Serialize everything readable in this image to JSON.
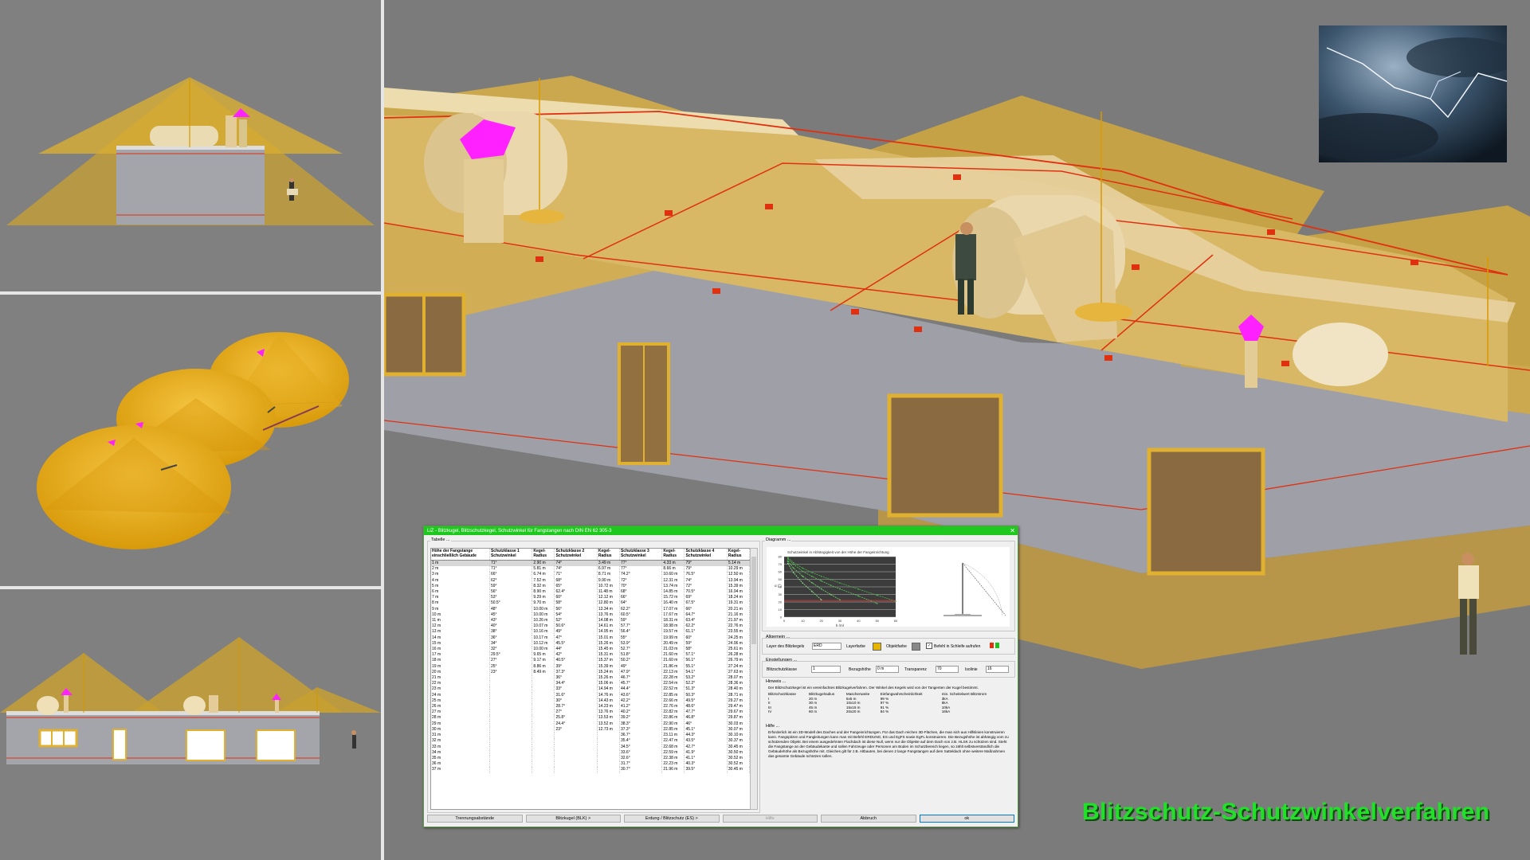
{
  "caption": "Blitzschutz-Schutzwinkelverfahren",
  "colors": {
    "cone": "#e3b31d",
    "building": "#d9b564",
    "wall_gray": "#9d9da6",
    "conductor": "#e03010",
    "roof_fixture": "#ff21ff",
    "caption_green": "#22e02a"
  },
  "icons": {
    "close": "close-icon",
    "color_swatch": "color-swatch-icon",
    "checkbox": "checkbox-icon"
  },
  "dialog": {
    "title": "LiZ - Blitzkugel, Blitzschutzkegel, Schutzwinkel für Fangstangen nach DIN EN 62 305-3",
    "close_glyph": "✕",
    "table_group": "Tabelle ...",
    "diagram_group": "Diagramm ...",
    "diagram_title": "Schutzwinkel in Abhängigkeit von der Höhe der Fangeinrichtung",
    "headers": [
      "Höhe der Fangstange einschließlich Gebäude",
      "Schutzklasse 1 Schutzwinkel",
      "Kegel-Radius",
      "Schutzklasse 2 Schutzwinkel",
      "Kegel-Radius",
      "Schutzklasse 3 Schutzwinkel",
      "Kegel-Radius",
      "Schutzklasse 4 Schutzwinkel",
      "Kegel-Radius"
    ],
    "rows": [
      [
        "1 m",
        "71°",
        "2.90 m",
        "74°",
        "3.49 m",
        "77°",
        "4.33 m",
        "79°",
        "5.14 m"
      ],
      [
        "2 m",
        "71°",
        "5.81 m",
        "74°",
        "6.97 m",
        "77°",
        "8.66 m",
        "79°",
        "10.29 m"
      ],
      [
        "3 m",
        "66°",
        "6.74 m",
        "71°",
        "8.71 m",
        "74.2°",
        "10.60 m",
        "76.5°",
        "12.50 m"
      ],
      [
        "4 m",
        "62°",
        "7.52 m",
        "68°",
        "9.90 m",
        "72°",
        "12.31 m",
        "74°",
        "13.94 m"
      ],
      [
        "5 m",
        "59°",
        "8.32 m",
        "65°",
        "10.72 m",
        "70°",
        "13.74 m",
        "72°",
        "15.39 m"
      ],
      [
        "6 m",
        "56°",
        "8.90 m",
        "62.4°",
        "11.48 m",
        "68°",
        "14.85 m",
        "70.5°",
        "16.94 m"
      ],
      [
        "7 m",
        "53°",
        "9.29 m",
        "60°",
        "12.12 m",
        "66°",
        "15.72 m",
        "69°",
        "18.24 m"
      ],
      [
        "8 m",
        "50.5°",
        "9.70 m",
        "58°",
        "12.80 m",
        "64°",
        "16.40 m",
        "67.5°",
        "19.31 m"
      ],
      [
        "9 m",
        "48°",
        "10.00 m",
        "56°",
        "13.34 m",
        "62.2°",
        "17.07 m",
        "66°",
        "20.21 m"
      ],
      [
        "10 m",
        "45°",
        "10.00 m",
        "54°",
        "13.76 m",
        "60.5°",
        "17.67 m",
        "64.7°",
        "21.16 m"
      ],
      [
        "11 m",
        "43°",
        "10.26 m",
        "52°",
        "14.08 m",
        "59°",
        "18.31 m",
        "63.4°",
        "21.97 m"
      ],
      [
        "12 m",
        "40°",
        "10.07 m",
        "50.6°",
        "14.61 m",
        "57.7°",
        "18.98 m",
        "62.2°",
        "22.76 m"
      ],
      [
        "13 m",
        "38°",
        "10.16 m",
        "49°",
        "14.95 m",
        "56.4°",
        "19.57 m",
        "61.1°",
        "23.55 m"
      ],
      [
        "14 m",
        "36°",
        "10.17 m",
        "47°",
        "15.01 m",
        "55°",
        "19.99 m",
        "60°",
        "24.25 m"
      ],
      [
        "15 m",
        "34°",
        "10.12 m",
        "45.5°",
        "15.26 m",
        "53.9°",
        "20.49 m",
        "59°",
        "24.96 m"
      ],
      [
        "16 m",
        "32°",
        "10.00 m",
        "44°",
        "15.45 m",
        "52.7°",
        "21.03 m",
        "58°",
        "25.61 m"
      ],
      [
        "17 m",
        "29.5°",
        "9.65 m",
        "42°",
        "15.31 m",
        "51.8°",
        "21.60 m",
        "57.1°",
        "26.28 m"
      ],
      [
        "18 m",
        "27°",
        "9.17 m",
        "40.5°",
        "15.37 m",
        "50.2°",
        "21.60 m",
        "56.1°",
        "26.79 m"
      ],
      [
        "19 m",
        "25°",
        "8.86 m",
        "39°",
        "15.39 m",
        "49°",
        "21.86 m",
        "55.1°",
        "27.24 m"
      ],
      [
        "20 m",
        "23°",
        "8.49 m",
        "37.3°",
        "15.24 m",
        "47.9°",
        "22.13 m",
        "54.1°",
        "27.63 m"
      ],
      [
        "21 m",
        "",
        "",
        "36°",
        "15.26 m",
        "46.7°",
        "22.28 m",
        "53.2°",
        "28.07 m"
      ],
      [
        "22 m",
        "",
        "",
        "34.4°",
        "15.06 m",
        "45.7°",
        "22.54 m",
        "52.2°",
        "28.36 m"
      ],
      [
        "23 m",
        "",
        "",
        "33°",
        "14.94 m",
        "44.4°",
        "22.52 m",
        "51.3°",
        "28.40 m"
      ],
      [
        "24 m",
        "",
        "",
        "31.6°",
        "14.76 m",
        "43.6°",
        "22.85 m",
        "50.3°",
        "28.71 m"
      ],
      [
        "25 m",
        "",
        "",
        "30°",
        "14.43 m",
        "42.2°",
        "22.66 m",
        "49.5°",
        "29.27 m"
      ],
      [
        "26 m",
        "",
        "",
        "28.7°",
        "14.23 m",
        "41.2°",
        "22.76 m",
        "48.6°",
        "29.47 m"
      ],
      [
        "27 m",
        "",
        "",
        "27°",
        "13.76 m",
        "40.2°",
        "22.82 m",
        "47.7°",
        "29.67 m"
      ],
      [
        "28 m",
        "",
        "",
        "25.8°",
        "13.53 m",
        "39.2°",
        "22.86 m",
        "46.8°",
        "29.87 m"
      ],
      [
        "29 m",
        "",
        "",
        "24.4°",
        "13.52 m",
        "38.3°",
        "22.90 m",
        "46°",
        "30.03 m"
      ],
      [
        "30 m",
        "",
        "",
        "23°",
        "12.73 m",
        "37.3°",
        "22.85 m",
        "45.1°",
        "30.07 m"
      ],
      [
        "31 m",
        "",
        "",
        "",
        "",
        "36.7°",
        "23.11 m",
        "44.3°",
        "30.10 m"
      ],
      [
        "32 m",
        "",
        "",
        "",
        "",
        "35.4°",
        "22.47 m",
        "43.5°",
        "30.37 m"
      ],
      [
        "33 m",
        "",
        "",
        "",
        "",
        "34.5°",
        "22.68 m",
        "42.7°",
        "30.45 m"
      ],
      [
        "34 m",
        "",
        "",
        "",
        "",
        "33.6°",
        "22.59 m",
        "41.9°",
        "30.50 m"
      ],
      [
        "35 m",
        "",
        "",
        "",
        "",
        "32.6°",
        "22.38 m",
        "41.1°",
        "30.52 m"
      ],
      [
        "36 m",
        "",
        "",
        "",
        "",
        "31.7°",
        "22.23 m",
        "40.3°",
        "30.52 m"
      ],
      [
        "37 m",
        "",
        "",
        "",
        "",
        "30.7°",
        "21.96 m",
        "39.5°",
        "30.45 m"
      ]
    ],
    "general_group": "Allgemein ...",
    "layer_label": "Layer des Blitzkegels",
    "layer_value": "ERD",
    "layer_color_label": "Layerfarbe",
    "object_color_label": "Objektfarbe",
    "loop_label": "Befehl in Schleife aufrufen",
    "settings_group": "Einstellungen ...",
    "class_label": "Blitzschutzklasse",
    "class_value": "1",
    "refheight_label": "Bezugshöhe",
    "refheight_value": "0 m",
    "transparency_label": "Transparenz",
    "transparency_value": "70",
    "isolines_label": "Isolinie",
    "isolines_value": "16",
    "notes_group": "Hinweis ...",
    "notes_intro": "Der Blitzschutzkegel ist ein vereinfachtes Blitzkugelverfahren. Der Winkel des Kegels wird von der Tangenten der Kugel bestimmt.",
    "info_headers": [
      "Blitzschutzklasse",
      "Blitzkugelradius",
      "Maschenweite",
      "Einfangwahrscheinlichkeit",
      "min. Scheitelwert Blitzstrom"
    ],
    "info_rows": [
      [
        "I",
        "20 m",
        "5x5 m",
        "99 %",
        "3kA"
      ],
      [
        "II",
        "30 m",
        "10x10 m",
        "97 %",
        "5kA"
      ],
      [
        "III",
        "45 m",
        "15x15 m",
        "91 %",
        "10kA"
      ],
      [
        "IV",
        "60 m",
        "20x20 m",
        "84 %",
        "16kA"
      ]
    ],
    "help_title": "Hilfe ...",
    "help_text": "Erforderlich ist ein 3D-Modell des Daches und der Fangeinrichtungen. Für das Dach reichen 3D-Flächen, die man sich aus Hilfslinien konstruieren kann. Fangspitzen und Fangleitungen kann man mit Befehl ERDUNG, ES und EgFS sowie EgFL konstruieren. Die Bezugshöhe ist abhängig vom zu schützenden Objekt. Bei einem ausgedehnten Flachdach ist diese Null, wenn nur die Objekte auf dem Dach von z.B. HLSK zu schützen sind. Steht die Fangstange an der Gebäudekante und sollen Fahrzeuge oder Personen am Boden im Schutzbereich liegen, so zählt selbstverständlich die Gebäudehöhe als Bezugshöhe mit. Gleiches gilt für z.B. Altbauten, bei denen 2 lange Fangstangen auf dem Satteldach ohne weitere Maßnahmen das gesamte Gebäude schützen sollen.",
    "buttons": [
      "Trennungsabstände",
      "Blitzkugel (BLK) >",
      "Erdung / Blitzschutz (ES) >",
      "Hilfe",
      "Abbruch",
      "ok"
    ],
    "chart_data": {
      "type": "line",
      "title": "Schutzwinkel in Abhängigkeit von der Höhe der Fangeinrichtung",
      "ylabel": "α (°)",
      "xlabel": "h (m)",
      "xlim": [
        0,
        60
      ],
      "ylim": [
        0,
        80
      ],
      "yticks": [
        0,
        10,
        20,
        30,
        40,
        50,
        60,
        70,
        80
      ],
      "xticks": [
        0,
        10,
        20,
        30,
        40,
        50,
        60
      ],
      "x": [
        2,
        5,
        10,
        15,
        20,
        25,
        30,
        40,
        50,
        60
      ],
      "series": [
        {
          "values": [
            71,
            59,
            45,
            34,
            23,
            null,
            null,
            null,
            null,
            null
          ]
        },
        {
          "values": [
            74,
            65,
            54,
            45.5,
            37.3,
            30,
            23,
            null,
            null,
            null
          ]
        },
        {
          "values": [
            77,
            70,
            60.5,
            53.9,
            47.9,
            42.2,
            37.3,
            28,
            18,
            null
          ]
        },
        {
          "values": [
            79,
            72,
            64.7,
            59,
            54.1,
            49.5,
            45.1,
            37,
            29,
            21
          ]
        }
      ]
    }
  }
}
